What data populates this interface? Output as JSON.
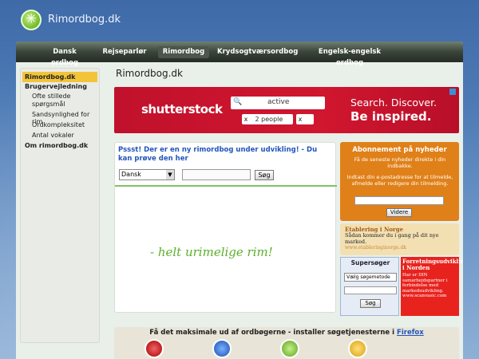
{
  "site": {
    "name": "Rimordbog.dk",
    "logo_icon": "rimordbog-logo-icon"
  },
  "nav": {
    "items": [
      {
        "label": "Dansk ordbog",
        "active": false
      },
      {
        "label": "Rejseparlør",
        "active": false
      },
      {
        "label": "Rimordbog",
        "active": true
      },
      {
        "label": "Krydsogtværsordbog",
        "active": false
      },
      {
        "label": "Engelsk-engelsk ordbog",
        "active": false
      }
    ]
  },
  "sidebar": {
    "items": [
      {
        "label": "Rimordbog.dk",
        "type": "active"
      },
      {
        "label": "Brugervejledning",
        "type": "head"
      },
      {
        "label": "Ofte stillede spørgsmål",
        "type": "sub"
      },
      {
        "label": "Sandsynlighed for rim",
        "type": "sub"
      },
      {
        "label": "Ordkompleksitet",
        "type": "sub"
      },
      {
        "label": "Antal vokaler",
        "type": "sub"
      },
      {
        "label": "Om rimordbog.dk",
        "type": "head"
      }
    ]
  },
  "main": {
    "title": "Rimordbog.dk",
    "headline": "Pssst! Der er en ny rimordbog under udvikling! - Du kan prøve den her",
    "language_select": "Dansk",
    "search_button": "Søg",
    "tagline": "- helt urimelige rim!"
  },
  "ad": {
    "brand": "shutterstock",
    "search_text": "active",
    "chip_people": "2 people",
    "chip_x": "x",
    "headline1": "Search. Discover.",
    "headline2": "Be inspired."
  },
  "newsletter": {
    "title": "Abonnement på nyheder",
    "text1": "Få de seneste nyheder direkte i din indbakke.",
    "text2": "Indtast din e-postadresse for at tilmelde, afmelde eller redigere din tilmelding.",
    "button": "Videre"
  },
  "promo_beige": {
    "title": "Etablering i Norge",
    "text": "Sådan kommer du i gang på dit nye marked.",
    "link": "www.etableringinorge.dk"
  },
  "supersoger": {
    "title": "Supersøger",
    "select": "Vælg søgemetode",
    "button": "Søg"
  },
  "promo_red": {
    "title": "Forretningsudvikling i Norden",
    "text": "Har er DIN samarbejdspartner i forbindelse med markedsudvikling. www.scanvasic.com"
  },
  "bottom": {
    "text": "Få det maksimale ud af ordbøgerne - installer søgetjenesterne i",
    "link": "Firefox",
    "colors": {
      "accent_green": "#5bb02a",
      "brand_red": "#c0112c",
      "orange": "#e08018"
    }
  }
}
